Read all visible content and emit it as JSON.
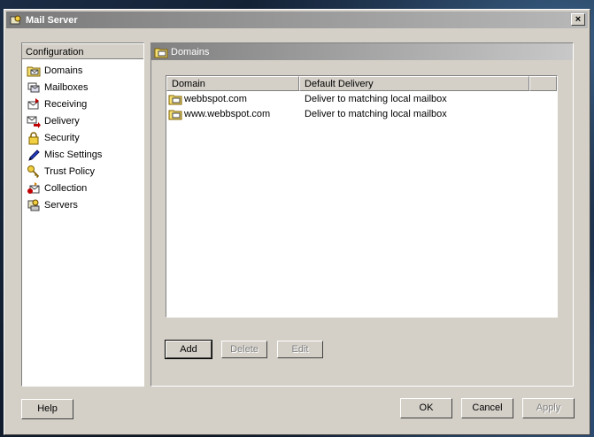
{
  "window": {
    "title": "Mail Server",
    "close_label": "×"
  },
  "sidebar": {
    "header": "Configuration",
    "items": [
      {
        "label": "Domains",
        "icon": "folder-mail-icon"
      },
      {
        "label": "Mailboxes",
        "icon": "mailboxes-icon"
      },
      {
        "label": "Receiving",
        "icon": "receiving-icon"
      },
      {
        "label": "Delivery",
        "icon": "delivery-icon"
      },
      {
        "label": "Security",
        "icon": "lock-icon"
      },
      {
        "label": "Misc Settings",
        "icon": "pen-icon"
      },
      {
        "label": "Trust Policy",
        "icon": "key-icon"
      },
      {
        "label": "Collection",
        "icon": "collection-icon"
      },
      {
        "label": "Servers",
        "icon": "servers-icon"
      }
    ]
  },
  "main": {
    "title": "Domains",
    "columns": [
      "Domain",
      "Default Delivery"
    ],
    "rows": [
      {
        "domain": "webbspot.com",
        "delivery": "Deliver to matching local mailbox"
      },
      {
        "domain": "www.webbspot.com",
        "delivery": "Deliver to matching local mailbox"
      }
    ],
    "buttons": {
      "add": "Add",
      "delete": "Delete",
      "edit": "Edit"
    }
  },
  "footer": {
    "help": "Help",
    "ok": "OK",
    "cancel": "Cancel",
    "apply": "Apply"
  }
}
